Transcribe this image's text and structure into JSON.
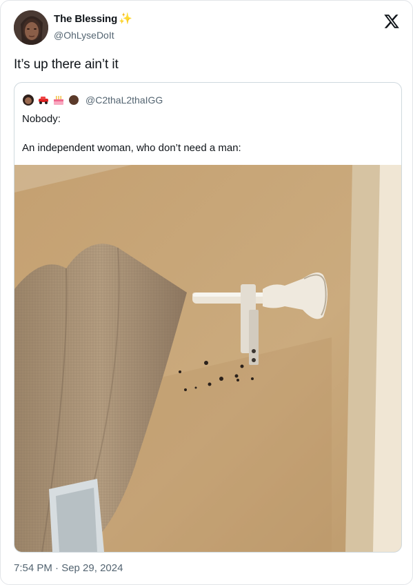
{
  "author": {
    "display_name": "The Blessing",
    "handle": "@OhLyseDoIt",
    "avatar_icon": "profile-photo-avatar",
    "badge_icon": "sparkles-icon"
  },
  "tweet_text": "It’s up there ain’t it",
  "quoted": {
    "handle": "@C2thaL2thaIGG",
    "emoji_icons": [
      "woman-profile-emoji",
      "car-emoji",
      "birthday-cake-emoji",
      "dark-brown-circle-emoji"
    ],
    "line1": "Nobody:",
    "line2": "An independent woman, who don’t need a man:",
    "image_icon": "curtain-rod-photo"
  },
  "timestamp": "7:54 PM · Sep 29, 2024",
  "platform_icon": "x-logo-icon",
  "colors": {
    "text": "#0f1419",
    "secondary": "#536471",
    "border": "#cfd9de",
    "wall": "#c9a575",
    "curtain": "#a89276"
  }
}
